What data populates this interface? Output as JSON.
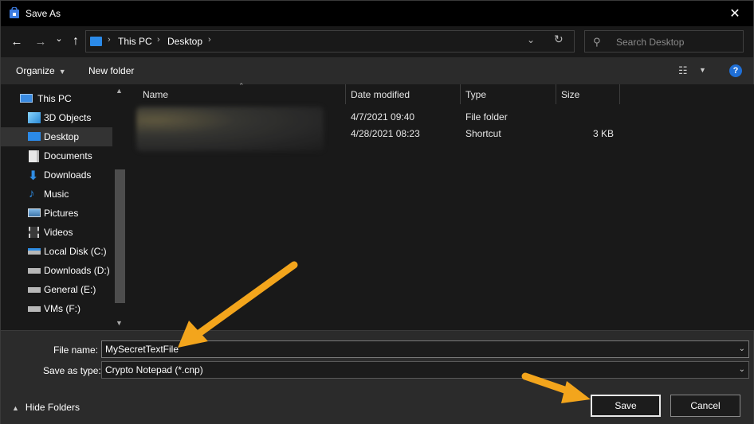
{
  "window": {
    "title": "Save As",
    "close_glyph": "✕"
  },
  "navigation": {
    "back_glyph": "←",
    "forward_glyph": "→",
    "recent_glyph": "⌄",
    "up_glyph": "↑",
    "breadcrumbs": [
      "This PC",
      "Desktop"
    ],
    "search_placeholder": "Search Desktop"
  },
  "toolbar": {
    "organize_label": "Organize",
    "new_folder_label": "New folder",
    "help_glyph": "?"
  },
  "nav_pane": {
    "items": [
      {
        "label": "This PC",
        "icon": "pc-icon"
      },
      {
        "label": "3D Objects",
        "icon": "3d-objects-icon"
      },
      {
        "label": "Desktop",
        "icon": "desktop-icon"
      },
      {
        "label": "Documents",
        "icon": "documents-icon"
      },
      {
        "label": "Downloads",
        "icon": "downloads-icon"
      },
      {
        "label": "Music",
        "icon": "music-icon"
      },
      {
        "label": "Pictures",
        "icon": "pictures-icon"
      },
      {
        "label": "Videos",
        "icon": "videos-icon"
      },
      {
        "label": "Local Disk (C:)",
        "icon": "disk-icon"
      },
      {
        "label": "Downloads (D:)",
        "icon": "drive-icon"
      },
      {
        "label": "General (E:)",
        "icon": "drive-icon"
      },
      {
        "label": "VMs (F:)",
        "icon": "drive-icon"
      }
    ],
    "selected": "Desktop"
  },
  "file_list": {
    "columns": [
      "Name",
      "Date modified",
      "Type",
      "Size"
    ],
    "rows": [
      {
        "date": "4/7/2021 09:40",
        "type": "File folder",
        "size": ""
      },
      {
        "date": "4/28/2021 08:23",
        "type": "Shortcut",
        "size": "3 KB"
      }
    ]
  },
  "save_panel": {
    "file_name_label": "File name:",
    "file_name_value": "MySecretTextFile",
    "save_type_label": "Save as type:",
    "save_type_value": "Crypto Notepad (*.cnp)",
    "hide_folders_label": "Hide Folders",
    "save_label": "Save",
    "cancel_label": "Cancel"
  },
  "colors": {
    "arrow": "#f3a51c",
    "accent": "#1f6fd6",
    "background": "#191919"
  }
}
